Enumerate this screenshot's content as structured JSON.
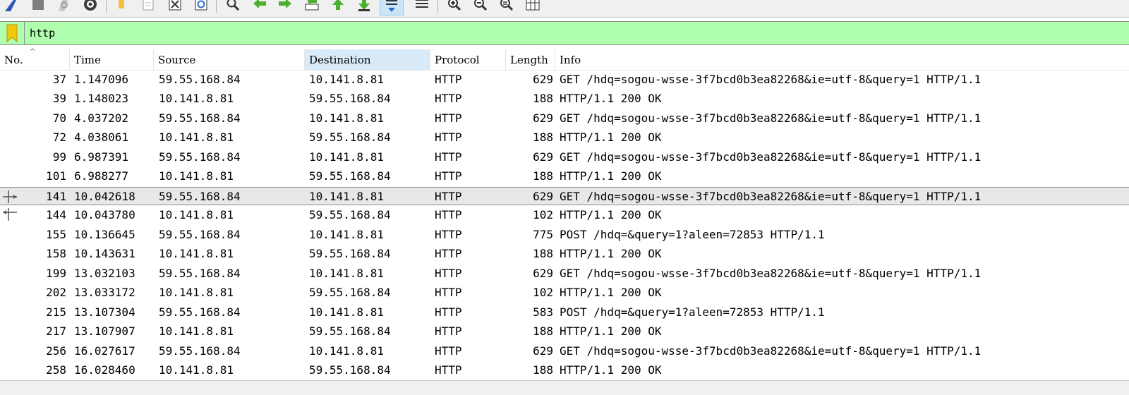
{
  "toolbar": {
    "buttons": [
      {
        "icon": "shark-fin-icon"
      },
      {
        "icon": "stop-icon"
      },
      {
        "icon": "restart-icon"
      },
      {
        "icon": "capture-options-icon"
      },
      {
        "icon": "open-file-icon"
      },
      {
        "icon": "save-file-icon"
      },
      {
        "icon": "close-file-icon"
      },
      {
        "icon": "reload-file-icon"
      },
      {
        "icon": "find-packet-icon"
      },
      {
        "icon": "go-back-icon"
      },
      {
        "icon": "go-forward-icon"
      },
      {
        "icon": "go-to-packet-icon"
      },
      {
        "icon": "go-first-icon"
      },
      {
        "icon": "go-last-icon"
      },
      {
        "icon": "auto-scroll-icon"
      },
      {
        "icon": "colorize-icon"
      },
      {
        "icon": "zoom-in-icon"
      },
      {
        "icon": "zoom-out-icon"
      },
      {
        "icon": "normal-size-icon"
      },
      {
        "icon": "resize-columns-icon"
      }
    ]
  },
  "filter": {
    "value": "http",
    "color": "#afffaf"
  },
  "columns": [
    "No.",
    "Time",
    "Source",
    "Destination",
    "Protocol",
    "Length",
    "Info"
  ],
  "sorted_column": "Destination",
  "packets": [
    {
      "no": "37",
      "time": "1.147096",
      "src": "59.55.168.84",
      "dst": "10.141.8.81",
      "proto": "HTTP",
      "len": "629",
      "info": "GET /hdq=sogou-wsse-3f7bcd0b3ea82268&ie=utf-8&query=1 HTTP/1.1"
    },
    {
      "no": "39",
      "time": "1.148023",
      "src": "10.141.8.81",
      "dst": "59.55.168.84",
      "proto": "HTTP",
      "len": "188",
      "info": "HTTP/1.1 200 OK"
    },
    {
      "no": "70",
      "time": "4.037202",
      "src": "59.55.168.84",
      "dst": "10.141.8.81",
      "proto": "HTTP",
      "len": "629",
      "info": "GET /hdq=sogou-wsse-3f7bcd0b3ea82268&ie=utf-8&query=1 HTTP/1.1"
    },
    {
      "no": "72",
      "time": "4.038061",
      "src": "10.141.8.81",
      "dst": "59.55.168.84",
      "proto": "HTTP",
      "len": "188",
      "info": "HTTP/1.1 200 OK"
    },
    {
      "no": "99",
      "time": "6.987391",
      "src": "59.55.168.84",
      "dst": "10.141.8.81",
      "proto": "HTTP",
      "len": "629",
      "info": "GET /hdq=sogou-wsse-3f7bcd0b3ea82268&ie=utf-8&query=1 HTTP/1.1"
    },
    {
      "no": "101",
      "time": "6.988277",
      "src": "10.141.8.81",
      "dst": "59.55.168.84",
      "proto": "HTTP",
      "len": "188",
      "info": "HTTP/1.1 200 OK"
    },
    {
      "no": "141",
      "time": "10.042618",
      "src": "59.55.168.84",
      "dst": "10.141.8.81",
      "proto": "HTTP",
      "len": "629",
      "info": "GET /hdq=sogou-wsse-3f7bcd0b3ea82268&ie=utf-8&query=1 HTTP/1.1",
      "selected": true
    },
    {
      "no": "144",
      "time": "10.043780",
      "src": "10.141.8.81",
      "dst": "59.55.168.84",
      "proto": "HTTP",
      "len": "102",
      "info": "HTTP/1.1 200 OK"
    },
    {
      "no": "155",
      "time": "10.136645",
      "src": "59.55.168.84",
      "dst": "10.141.8.81",
      "proto": "HTTP",
      "len": "775",
      "info": "POST /hdq=&query=1?aleen=72853 HTTP/1.1"
    },
    {
      "no": "158",
      "time": "10.143631",
      "src": "10.141.8.81",
      "dst": "59.55.168.84",
      "proto": "HTTP",
      "len": "188",
      "info": "HTTP/1.1 200 OK"
    },
    {
      "no": "199",
      "time": "13.032103",
      "src": "59.55.168.84",
      "dst": "10.141.8.81",
      "proto": "HTTP",
      "len": "629",
      "info": "GET /hdq=sogou-wsse-3f7bcd0b3ea82268&ie=utf-8&query=1 HTTP/1.1"
    },
    {
      "no": "202",
      "time": "13.033172",
      "src": "10.141.8.81",
      "dst": "59.55.168.84",
      "proto": "HTTP",
      "len": "102",
      "info": "HTTP/1.1 200 OK"
    },
    {
      "no": "215",
      "time": "13.107304",
      "src": "59.55.168.84",
      "dst": "10.141.8.81",
      "proto": "HTTP",
      "len": "583",
      "info": "POST /hdq=&query=1?aleen=72853 HTTP/1.1"
    },
    {
      "no": "217",
      "time": "13.107907",
      "src": "10.141.8.81",
      "dst": "59.55.168.84",
      "proto": "HTTP",
      "len": "188",
      "info": "HTTP/1.1 200 OK"
    },
    {
      "no": "256",
      "time": "16.027617",
      "src": "59.55.168.84",
      "dst": "10.141.8.81",
      "proto": "HTTP",
      "len": "629",
      "info": "GET /hdq=sogou-wsse-3f7bcd0b3ea82268&ie=utf-8&query=1 HTTP/1.1"
    },
    {
      "no": "258",
      "time": "16.028460",
      "src": "10.141.8.81",
      "dst": "59.55.168.84",
      "proto": "HTTP",
      "len": "188",
      "info": "HTTP/1.1 200 OK"
    }
  ]
}
